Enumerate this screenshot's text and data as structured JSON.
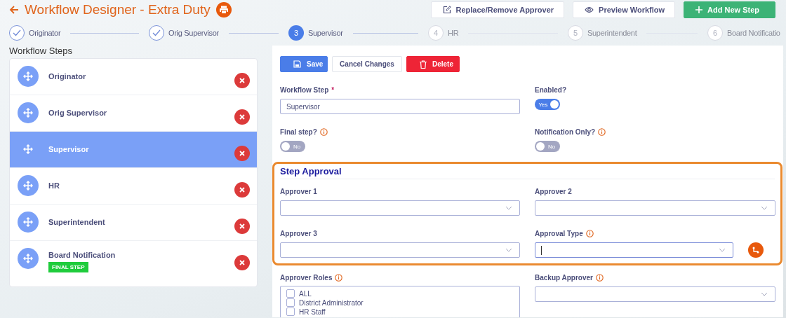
{
  "header": {
    "title": "Workflow Designer - Extra Duty",
    "buttons": [
      {
        "label": "Replace/Remove Approver",
        "kind": "edit"
      },
      {
        "label": "Preview Workflow",
        "kind": "preview"
      },
      {
        "label": "Add New Step",
        "kind": "add"
      }
    ]
  },
  "stepper": [
    {
      "label": "Originator",
      "completed": true,
      "selected": false
    },
    {
      "label": "Orig Supervisor",
      "completed": true,
      "selected": false
    },
    {
      "number": "3",
      "label": "Supervisor",
      "completed": false,
      "selected": true
    },
    {
      "number": "4",
      "label": "HR",
      "completed": false,
      "selected": false
    },
    {
      "number": "5",
      "label": "Superintendent",
      "completed": false,
      "selected": false
    },
    {
      "number": "6",
      "label": "Board Notificatio",
      "completed": false,
      "selected": false
    }
  ],
  "workflow_steps": {
    "title": "Workflow Steps",
    "items": [
      {
        "label": "Originator",
        "selected": false
      },
      {
        "label": "Orig Supervisor",
        "selected": false
      },
      {
        "label": "Supervisor",
        "selected": true
      },
      {
        "label": "HR",
        "selected": false
      },
      {
        "label": "Superintendent",
        "selected": false
      },
      {
        "label": "Board Notification",
        "selected": false,
        "badge": "FINAL STEP"
      }
    ]
  },
  "editor": {
    "actions": [
      {
        "label": "Save",
        "kind": "save"
      },
      {
        "label": "Cancel Changes",
        "kind": "cancel"
      },
      {
        "label": "Delete",
        "kind": "delete"
      }
    ],
    "workflow_step": {
      "label": "Workflow Step",
      "required_mark": "*",
      "value": "Supervisor"
    },
    "enabled": {
      "label": "Enabled?",
      "info": false,
      "on": true,
      "text": "Yes"
    },
    "final_step": {
      "label": "Final step?",
      "info": true,
      "on": false,
      "text": "No"
    },
    "notification_only": {
      "label": "Notification Only?",
      "info": true,
      "on": false,
      "text": "No"
    },
    "step_approval": {
      "title": "Step Approval",
      "fields": [
        {
          "label": "Approver 1",
          "info": false,
          "focused": false
        },
        {
          "label": "Approver 2",
          "info": false,
          "focused": false
        },
        {
          "label": "Approver 3",
          "info": false,
          "focused": false
        },
        {
          "label": "Approval Type",
          "info": true,
          "focused": true
        }
      ]
    },
    "approver_roles": {
      "label": "Approver Roles",
      "info": true,
      "options": [
        {
          "label": "ALL",
          "checked": false
        },
        {
          "label": "District Administrator",
          "checked": false
        },
        {
          "label": "HR Staff",
          "checked": false
        }
      ]
    },
    "backup_approver": {
      "label": "Backup Approver",
      "info": true
    }
  }
}
